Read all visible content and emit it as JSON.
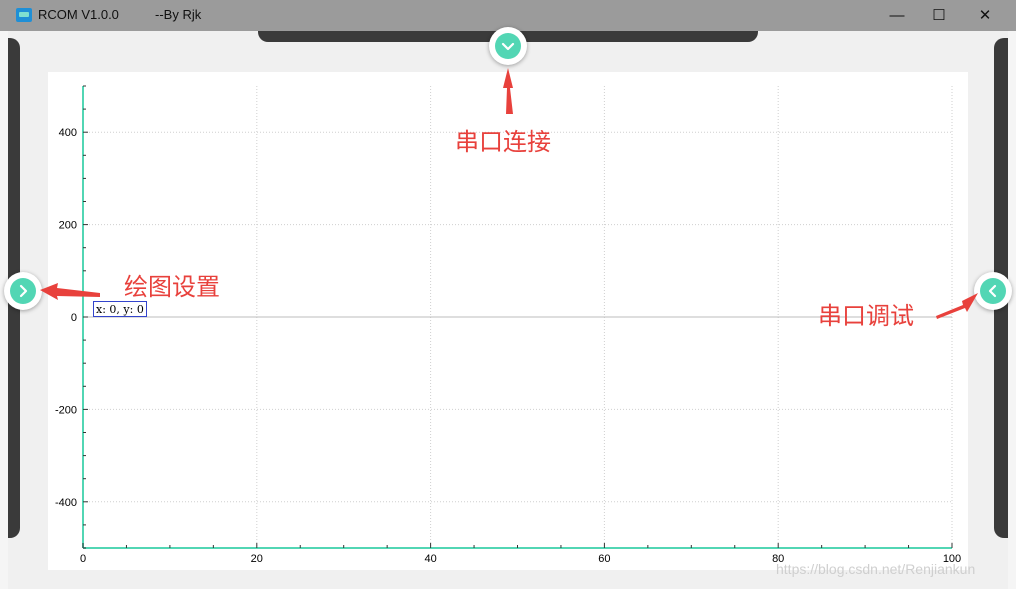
{
  "window": {
    "title": "RCOM V1.0.0",
    "author": "--By Rjk",
    "minimize_glyph": "—",
    "maximize_glyph": "☐",
    "close_glyph": "✕"
  },
  "toggles": {
    "top": "chevron-down-icon",
    "left": "chevron-right-icon",
    "right": "chevron-left-icon"
  },
  "colors": {
    "accent": "#52d6b4",
    "annotation": "#e8413c",
    "rail": "#3a3a3a"
  },
  "chart_data": {
    "type": "line",
    "x_ticks": [
      0,
      20,
      40,
      60,
      80,
      100
    ],
    "y_ticks": [
      400,
      200,
      0,
      -200,
      -400
    ],
    "xlim": [
      0,
      100
    ],
    "ylim": [
      -500,
      500
    ],
    "grid": true,
    "series": []
  },
  "coord_readout": "x: 0, y: 0",
  "annotations": {
    "top": "串口连接",
    "left": "绘图设置",
    "right": "串口调试"
  },
  "watermark": "https://blog.csdn.net/Renjiankun"
}
